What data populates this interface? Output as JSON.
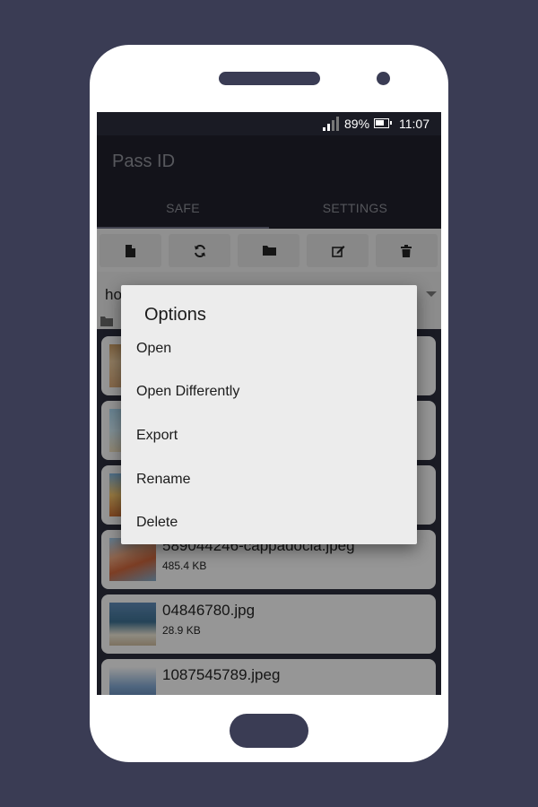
{
  "status_bar": {
    "battery": "89%",
    "time": "11:07"
  },
  "app": {
    "title": "Pass ID"
  },
  "tabs": [
    {
      "label": "SAFE"
    },
    {
      "label": "SETTINGS"
    }
  ],
  "toolbar": {
    "buttons": [
      {
        "icon": "new-file-icon"
      },
      {
        "icon": "refresh-icon"
      },
      {
        "icon": "folder-icon"
      },
      {
        "icon": "edit-icon"
      },
      {
        "icon": "trash-icon"
      }
    ]
  },
  "path_selector": {
    "value": "ho"
  },
  "files": [
    {
      "name": "",
      "size": ""
    },
    {
      "name": "",
      "size": ""
    },
    {
      "name": "",
      "size": ""
    },
    {
      "name": "589044246-cappadocia.jpeg",
      "size": "485.4 KB"
    },
    {
      "name": "04846780.jpg",
      "size": "28.9 KB"
    },
    {
      "name": "1087545789.jpeg",
      "size": ""
    }
  ],
  "dialog": {
    "title": "Options",
    "options": [
      {
        "label": "Open"
      },
      {
        "label": "Open Differently"
      },
      {
        "label": "Export"
      },
      {
        "label": "Rename"
      },
      {
        "label": "Delete"
      }
    ]
  }
}
